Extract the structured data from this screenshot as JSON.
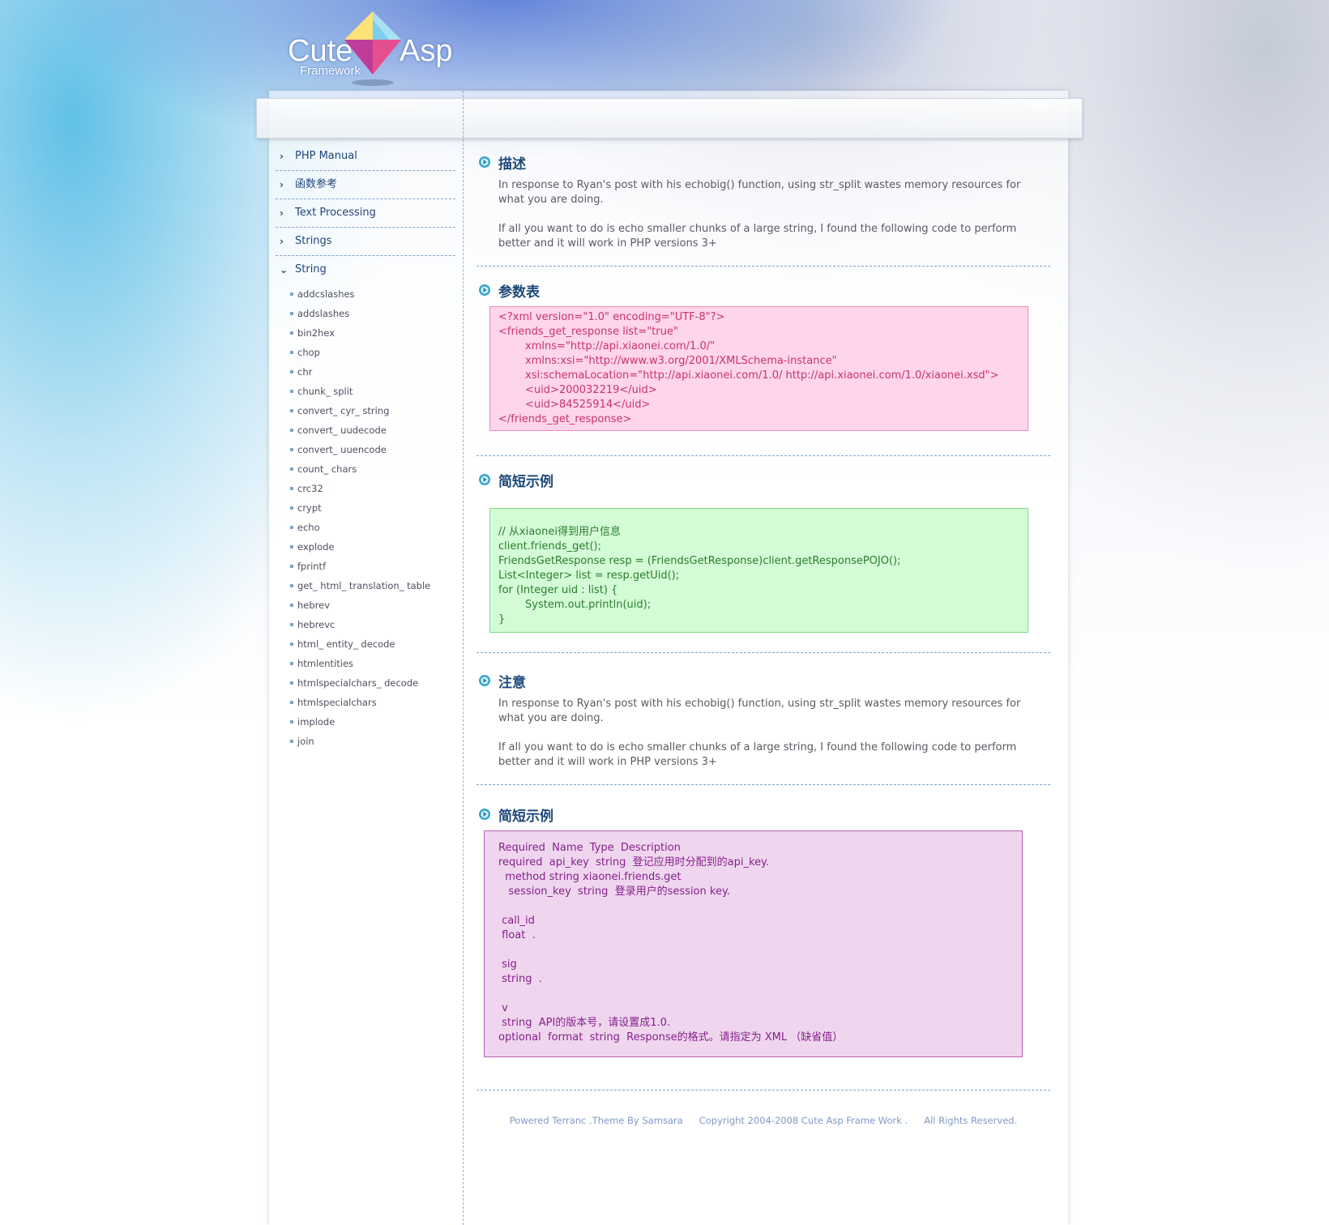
{
  "logo": {
    "word_left": "Cute",
    "word_right": "Asp",
    "sub": "Framework"
  },
  "nav": [
    {
      "label": "PHP Manual"
    },
    {
      "label": "函数参考"
    },
    {
      "label": "Text Processing"
    },
    {
      "label": "Strings"
    },
    {
      "label": "String"
    }
  ],
  "string_functions": [
    "addcslashes",
    "addslashes",
    "bin2hex",
    "chop",
    "chr",
    "chunk_ split",
    "convert_ cyr_ string",
    "convert_ uudecode",
    "convert_ uuencode",
    "count_ chars",
    "crc32",
    "crypt",
    "echo",
    "explode",
    "fprintf",
    "get_ html_ translation_ table",
    "hebrev",
    "hebrevc",
    "html_ entity_ decode",
    "htmlentities",
    "htmlspecialchars_ decode",
    "htmlspecialchars",
    "implode",
    "join"
  ],
  "sections": {
    "desc": {
      "title": "描述",
      "paragraphs": [
        "In response to Ryan's post with his echobig() function, using str_split wastes memory resources for what you are doing.",
        "If all you want to do is echo smaller chunks of a large string, I found the following code to perform better and it will work in PHP versions 3+"
      ]
    },
    "params": {
      "title": "参数表",
      "code": [
        "<?xml version=\"1.0\" encoding=\"UTF-8\"?>",
        "<friends_get_response list=\"true\"",
        "        xmlns=\"http://api.xiaonei.com/1.0/\"",
        "        xmlns:xsi=\"http://www.w3.org/2001/XMLSchema-instance\"",
        "        xsi:schemaLocation=\"http://api.xiaonei.com/1.0/ http://api.xiaonei.com/1.0/xiaonei.xsd\">",
        "        <uid>200032219</uid>",
        "        <uid>84525914</uid>",
        "</friends_get_response>"
      ]
    },
    "example1": {
      "title": "简短示例",
      "code": [
        "// 从xiaonei得到用户信息",
        "client.friends_get();",
        "FriendsGetResponse resp = (FriendsGetResponse)client.getResponsePOJO();",
        "List<Integer> list = resp.getUid();",
        "for (Integer uid : list) {",
        "        System.out.println(uid);",
        "}"
      ]
    },
    "note": {
      "title": "注意",
      "paragraphs": [
        "In response to Ryan's post with his echobig() function, using str_split wastes memory resources for what you are doing.",
        "If all you want to do is echo smaller chunks of a large string, I found the following code to perform better and it will work in PHP versions 3+"
      ]
    },
    "example2": {
      "title": "简短示例",
      "code": [
        "Required  Name  Type  Description",
        "required  api_key  string  登记应用时分配到的api_key.",
        "  method string xiaonei.friends.get",
        "   session_key  string  登录用户的session key.",
        "",
        " call_id",
        " float  .",
        "",
        " sig",
        " string  .",
        "",
        " v",
        " string  API的版本号，请设置成1.0.",
        "optional  format  string  Response的格式。请指定为 XML （缺省值）"
      ]
    }
  },
  "footer": {
    "powered": "Powered Terranc .Theme  By Samsara",
    "copyright": "Copyright 2004-2008 Cute Asp Frame Work .",
    "rights": "All Rights Reserved."
  },
  "colors": {
    "title": "#1f4a7a",
    "xml_bg": "#fed5ea",
    "java_bg": "#d3fbd6",
    "param_bg": "#efd6ee"
  }
}
